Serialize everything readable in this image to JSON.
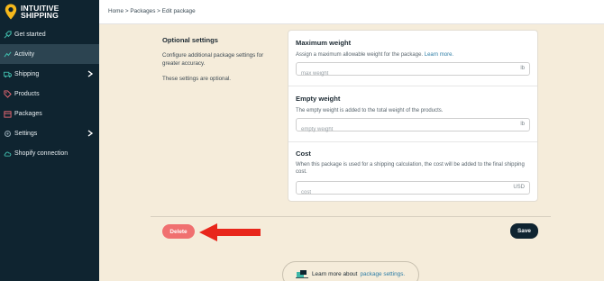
{
  "brand": {
    "name_line1": "INTUITIVE",
    "name_line2": "SHIPPING",
    "accent": "#f5b81c"
  },
  "sidebar": {
    "items": [
      {
        "label": "Get started",
        "icon": "rocket-icon"
      },
      {
        "label": "Activity",
        "icon": "activity-icon",
        "active": true
      },
      {
        "label": "Shipping",
        "icon": "truck-icon",
        "has_children": true
      },
      {
        "label": "Products",
        "icon": "tag-icon"
      },
      {
        "label": "Packages",
        "icon": "box-icon"
      },
      {
        "label": "Settings",
        "icon": "gear-icon",
        "has_children": true
      },
      {
        "label": "Shopify connection",
        "icon": "cloud-icon"
      }
    ]
  },
  "breadcrumb": {
    "text": "Home > Packages > Edit package"
  },
  "optional": {
    "heading": "Optional settings",
    "description": "Configure additional package settings for greater accuracy.",
    "note": "These settings are optional."
  },
  "max_weight": {
    "title": "Maximum weight",
    "description": "Assign a maximum allowable weight for the package.",
    "link": "Learn more.",
    "placeholder": "max weight",
    "unit": "lb"
  },
  "empty_weight": {
    "title": "Empty weight",
    "description": "The empty weight is added to the total weight of the products.",
    "placeholder": "empty weight",
    "unit": "lb"
  },
  "cost": {
    "title": "Cost",
    "description": "When this package is used for a shipping calculation, the cost will be added to the final shipping cost.",
    "placeholder": "cost",
    "unit": "USD"
  },
  "actions": {
    "delete_label": "Delete",
    "save_label": "Save"
  },
  "learn_more": {
    "text": "Learn more about",
    "link": "package settings."
  },
  "colors": {
    "sidebar": "#0f2430",
    "background": "#f5ecda",
    "delete": "#f07070",
    "arrow": "#e8261b",
    "link": "#2f7ea6"
  }
}
